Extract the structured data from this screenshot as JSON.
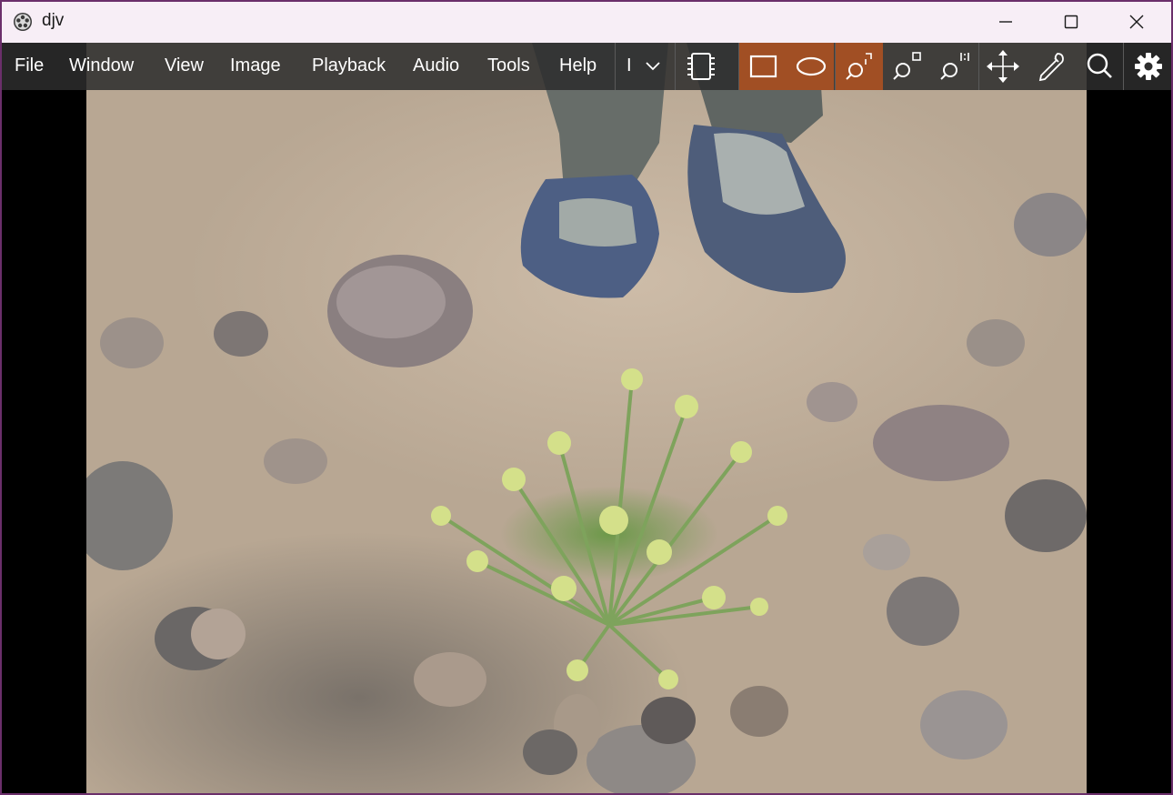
{
  "window": {
    "title": "djv"
  },
  "menu": {
    "file": "File",
    "window": "Window",
    "view": "View",
    "image": "Image",
    "playback": "Playback",
    "audio": "Audio",
    "tools": "Tools",
    "help": "Help"
  },
  "layer_select": {
    "value": "I"
  },
  "toolbar": {
    "icons": [
      "cpu-icon",
      "compare-rect-icon",
      "compare-ellipse-icon",
      "zoom-fit-window-icon",
      "zoom-fit-image-icon",
      "zoom-full-icon",
      "pan-icon",
      "color-picker-icon",
      "search-icon",
      "settings-icon"
    ],
    "active_icons": [
      "compare-rect-icon",
      "compare-ellipse-icon",
      "zoom-fit-window-icon"
    ],
    "active_color": "#a14f24"
  },
  "colors": {
    "titlebar": "#f7eef6",
    "toolbar": "#2c2c2c",
    "background": "#000000",
    "window_border": "#6b2f6b"
  }
}
